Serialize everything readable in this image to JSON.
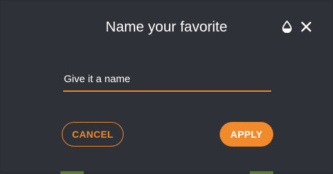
{
  "dialog": {
    "title": "Name your favorite",
    "icons": {
      "theme": "droplet-icon",
      "close": "close-icon"
    }
  },
  "name_field": {
    "value": "Give it a name"
  },
  "actions": {
    "cancel_label": "CANCEL",
    "apply_label": "APPLY"
  },
  "colors": {
    "accent": "#f0882a",
    "dialog_background": "#2f3138",
    "text": "#ffffff"
  }
}
